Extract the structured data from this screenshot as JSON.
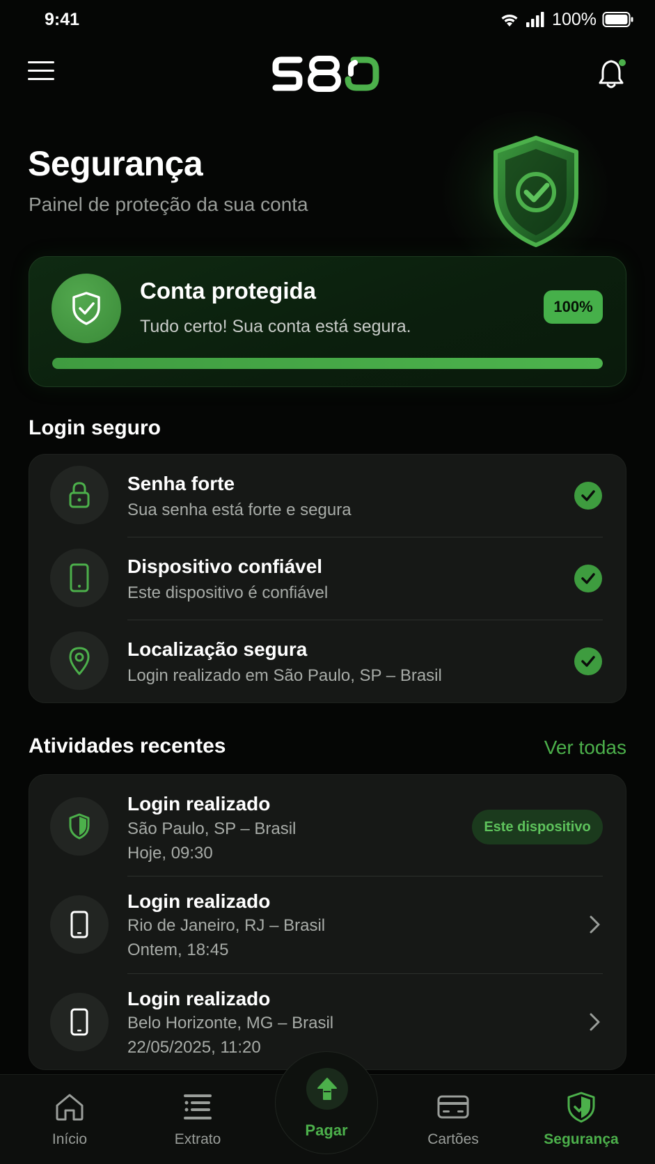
{
  "status_bar": {
    "time": "9:41",
    "battery": "100%"
  },
  "app_bar": {
    "logo": "580"
  },
  "hero": {
    "title": "Segurança",
    "subtitle": "Painel de proteção da sua conta"
  },
  "protection": {
    "title": "Conta protegida",
    "subtitle": "Tudo certo! Sua conta está segura.",
    "percent_label": "100%",
    "progress": 1.0
  },
  "login_section": {
    "title": "Login seguro",
    "items": [
      {
        "icon": "lock-icon",
        "title": "Senha forte",
        "subtitle": "Sua senha está forte e segura"
      },
      {
        "icon": "phone-icon",
        "title": "Dispositivo confiável",
        "subtitle": "Este dispositivo é confiável"
      },
      {
        "icon": "location-pin-icon",
        "title": "Localização segura",
        "subtitle": "Login realizado em São Paulo, SP – Brasil"
      }
    ]
  },
  "activity_section": {
    "title": "Atividades recentes",
    "see_all": "Ver todas",
    "items": [
      {
        "icon": "shield-icon",
        "title": "Login realizado",
        "location": "São Paulo, SP – Brasil",
        "time": "Hoje, 09:30",
        "badge": "Este dispositivo"
      },
      {
        "icon": "phone-icon",
        "title": "Login realizado",
        "location": "Rio de Janeiro, RJ – Brasil",
        "time": "Ontem, 18:45"
      },
      {
        "icon": "phone-icon",
        "title": "Login realizado",
        "location": "Belo Horizonte, MG – Brasil",
        "time": "22/05/2025, 11:20"
      }
    ]
  },
  "bottom_nav": {
    "items": [
      {
        "label": "Início",
        "icon": "home-icon"
      },
      {
        "label": "Extrato",
        "icon": "statement-icon"
      },
      {
        "label": "Pagar",
        "icon": "pay-icon"
      },
      {
        "label": "Cartões",
        "icon": "card-icon"
      },
      {
        "label": "Segurança",
        "icon": "shield-icon",
        "active": true
      }
    ]
  },
  "colors": {
    "accent": "#4cb04b",
    "background": "#050605",
    "card": "#161816"
  }
}
